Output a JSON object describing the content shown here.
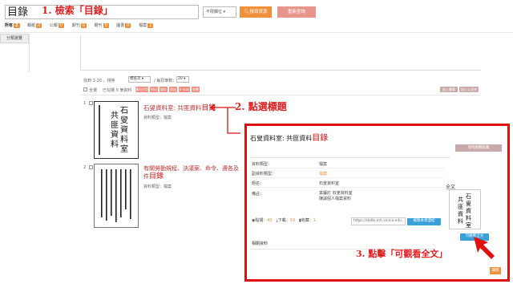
{
  "search": {
    "query": "目錄",
    "step1": "1. 檢索「目錄」",
    "field_select": "不限欄位",
    "search_button": "搜尋資源",
    "advanced_button": "重新查詢"
  },
  "tabs": [
    {
      "label": "所有",
      "count": "2"
    },
    {
      "label": "報紙",
      "count": "0"
    },
    {
      "label": "公報",
      "count": "0"
    },
    {
      "label": "期刊",
      "count": "0"
    },
    {
      "label": "期刊",
      "count": "0"
    },
    {
      "label": "圖書",
      "count": "0"
    },
    {
      "label": "檔案",
      "count": "2"
    }
  ],
  "sidebar": {
    "title": "分類瀏覽"
  },
  "results_bar": {
    "count_text": "找到 1-20 ，排序",
    "sort_value": "標名次",
    "per_page_label": "/ 每頁筆數：",
    "per_page_value": "20",
    "select_all": "全選",
    "selected_text": "已勾選 0 筆資料",
    "tools": [
      "匯出引用",
      "列印",
      "儲存",
      "寄送",
      "E-mail",
      "統整"
    ],
    "right_buttons": [
      "加入書單",
      "加入公文夾"
    ]
  },
  "results": [
    {
      "index": "1",
      "title_prefix": "石叟資料室: 共匪資料",
      "title_hl": "目錄",
      "type_label": "資料類型：",
      "type_value": "檔案"
    },
    {
      "index": "2",
      "title_prefix": "有關勞動規程、決議案、命令、遵各及",
      "title_hl": "目錄",
      "title_line2": "件",
      "type_label": "資料類型：",
      "type_value": "檔案"
    }
  ],
  "step2": "2. 點選標題",
  "step3": "3. 點擊「可觀看全文」",
  "detail": {
    "title_prefix": "石叟資料室: 共匪資料",
    "title_hl": "目錄",
    "related_button": "尋找相關館藏",
    "fields": [
      {
        "label": "資料類型：",
        "value": "檔案",
        "highlight": false
      },
      {
        "label": "副資料類型：",
        "value": "檔案",
        "highlight": true
      },
      {
        "label": "題名：",
        "value": "石叟資料室",
        "highlight": false
      },
      {
        "label": "備註：",
        "value": "其屬於 石叟資料室\n陳誠個人檔案資料",
        "highlight": false
      }
    ],
    "stats": {
      "views_label": "點閱：",
      "views": "45",
      "downloads_label": "下載：",
      "downloads": "53",
      "favorites_label": "收藏：",
      "favorites": "1"
    },
    "url": "https://dalib.mh.sinica.edu",
    "copy_button": "複製本頁連結",
    "fulltext_label": "全文",
    "view_fulltext_button": "可觀看全文",
    "related_section": "相關資料",
    "close_button": "關閉"
  }
}
